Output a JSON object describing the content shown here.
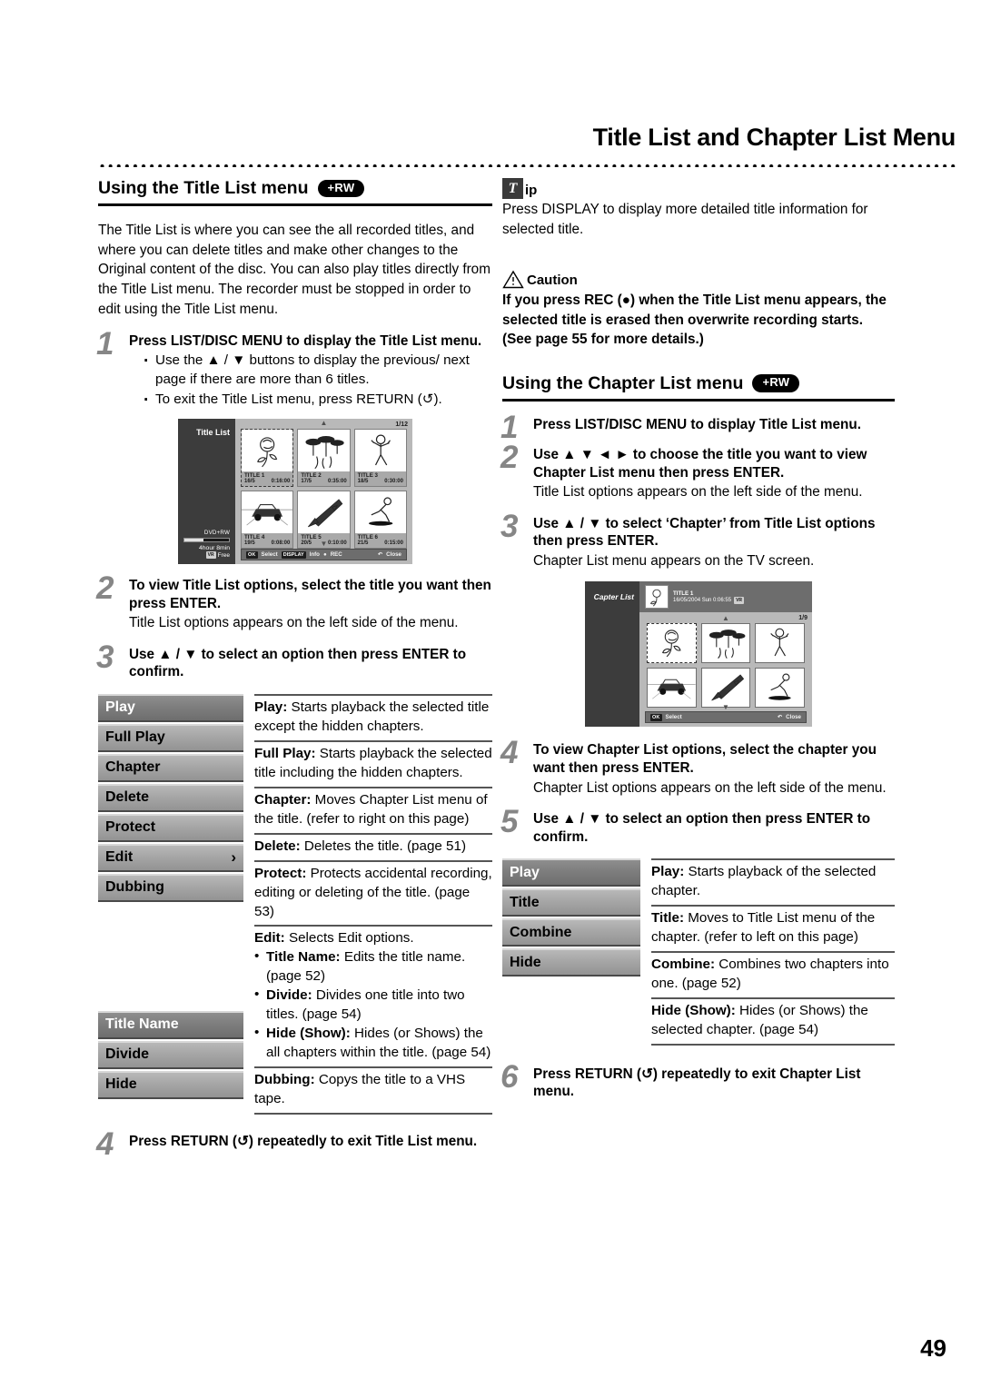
{
  "header": {
    "title": "Title List and Chapter List Menu"
  },
  "page_number": "49",
  "left": {
    "section_heading": "Using the Title List menu",
    "badge": "+RW",
    "intro": "The Title List is where you can see the all recorded titles, and where you can delete titles and make other changes to the Original content of the disc. You can also play titles directly from the Title List menu. The recorder must be stopped in order to edit using the Title List menu.",
    "steps": [
      {
        "num": "1",
        "head": "Press LIST/DISC MENU to display the Title List menu.",
        "bullets": [
          "Use the ▲ / ▼ buttons to display the previous/ next page if there are more than 6 titles.",
          "To exit the Title List menu, press RETURN (↺)."
        ]
      },
      {
        "num": "2",
        "head": "To view Title List options, select the title you want then press ENTER.",
        "sub": "Title List options appears on the left side of the menu."
      },
      {
        "num": "3",
        "head": "Use ▲ / ▼ to select an option then press ENTER to confirm."
      },
      {
        "num": "4",
        "head": "Press RETURN (↺) repeatedly to exit Title List menu."
      }
    ],
    "options_menu": [
      {
        "label": "Play",
        "selected": true
      },
      {
        "label": "Full Play",
        "selected": false
      },
      {
        "label": "Chapter",
        "selected": false
      },
      {
        "label": "Delete",
        "selected": false
      },
      {
        "label": "Protect",
        "selected": false
      },
      {
        "label": "Edit",
        "selected": false,
        "arrow": "›"
      },
      {
        "label": "Dubbing",
        "selected": false
      }
    ],
    "edit_submenu": [
      {
        "label": "Title Name",
        "selected": true
      },
      {
        "label": "Divide",
        "selected": false
      },
      {
        "label": "Hide",
        "selected": false
      }
    ],
    "descriptions": [
      {
        "term": "Play:",
        "text": " Starts playback the selected title except the hidden chapters."
      },
      {
        "term": "Full Play:",
        "text": " Starts playback the selected title including the hidden chapters."
      },
      {
        "term": "Chapter:",
        "text": " Moves Chapter List menu of the title. (refer to right on this page)"
      },
      {
        "term": "Delete:",
        "text": " Deletes the title. (page 51)"
      },
      {
        "term": "Protect:",
        "text": " Protects accidental recording, editing or deleting of the title. (page 53)"
      },
      {
        "term": "Edit:",
        "text": " Selects Edit options.",
        "sub_items": [
          {
            "term": "Title Name:",
            "text": " Edits the title name. (page 52)"
          },
          {
            "term": "Divide:",
            "text": " Divides one title into two titles. (page 54)"
          },
          {
            "term": "Hide (Show):",
            "text": " Hides (or Shows) the all chapters within the title. (page 54)"
          }
        ]
      },
      {
        "term": "Dubbing:",
        "text": " Copys the title to a VHS tape."
      }
    ],
    "tv_mock": {
      "screen_title": "Title List",
      "disc_type": "DVD+RW",
      "remaining": "4hour 8min",
      "free_label": "Free",
      "free_icon": "VR",
      "page_indicator": "1/12",
      "titles": [
        {
          "name": "TITLE 1",
          "date": "16/5",
          "time": "0:16:00"
        },
        {
          "name": "TITLE 2",
          "date": "17/5",
          "time": "0:35:00"
        },
        {
          "name": "TITLE 3",
          "date": "18/5",
          "time": "0:30:00"
        },
        {
          "name": "TITLE 4",
          "date": "19/5",
          "time": "0:08:00"
        },
        {
          "name": "TITLE 5",
          "date": "20/5",
          "time": "0:10:00"
        },
        {
          "name": "TITLE 6",
          "date": "21/5",
          "time": "0:15:00"
        }
      ],
      "bar": {
        "ok_key": "OK",
        "select": "Select",
        "display_key": "DISPLAY",
        "info": "Info",
        "rec": "REC",
        "close": "Close"
      }
    }
  },
  "right": {
    "tip": {
      "glyph": "T",
      "word": "ip",
      "text": "Press DISPLAY to display more detailed title information for selected title."
    },
    "caution": {
      "word": "Caution",
      "text": "If you press REC (●) when the Title List menu appears, the selected title is erased then overwrite recording starts. (See page 55 for more details.)"
    },
    "section_heading": "Using the Chapter List menu",
    "badge": "+RW",
    "steps": [
      {
        "num": "1",
        "head": "Press LIST/DISC MENU to display Title List menu."
      },
      {
        "num": "2",
        "head": "Use ▲ ▼ ◄ ► to choose the title you want to view Chapter List menu then press ENTER.",
        "sub": "Title List options appears on the left side of the menu."
      },
      {
        "num": "3",
        "head": "Use ▲ / ▼ to select ‘Chapter’ from Title List options then press ENTER.",
        "sub": "Chapter List menu appears on the TV screen."
      },
      {
        "num": "4",
        "head": "To view Chapter List options, select the chapter you want then press ENTER.",
        "sub": "Chapter List options appears on the left side of the menu."
      },
      {
        "num": "5",
        "head": "Use ▲ / ▼ to select an option then press ENTER to confirm."
      },
      {
        "num": "6",
        "head": "Press RETURN (↺) repeatedly to exit Chapter List menu."
      }
    ],
    "options_menu": [
      {
        "label": "Play",
        "selected": true
      },
      {
        "label": "Title",
        "selected": false
      },
      {
        "label": "Combine",
        "selected": false
      },
      {
        "label": "Hide",
        "selected": false
      }
    ],
    "descriptions": [
      {
        "term": "Play:",
        "text": " Starts playback of the selected chapter."
      },
      {
        "term": "Title:",
        "text": " Moves to Title List menu of the chapter. (refer to left on this page)"
      },
      {
        "term": "Combine:",
        "text": " Combines two chapters into one. (page 52)"
      },
      {
        "term": "Hide (Show):",
        "text": " Hides (or Shows) the selected chapter. (page 54)"
      }
    ],
    "tv_mock": {
      "screen_title": "Capter List",
      "title_name": "TITLE 1",
      "title_date": "16/05/2004 Sun 0:06:55",
      "title_icon": "VR",
      "page_indicator": "1/9",
      "bar": {
        "ok_key": "OK",
        "select": "Select",
        "close": "Close"
      }
    }
  }
}
